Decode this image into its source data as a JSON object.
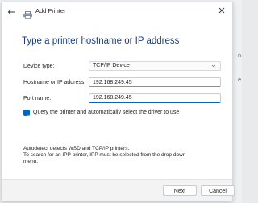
{
  "window": {
    "title": "Add Printer"
  },
  "heading": "Type a printer hostname or IP address",
  "form": {
    "device_type_label": "Device type:",
    "device_type_value": "TCP/IP Device",
    "hostname_label": "Hostname or IP address:",
    "hostname_value": "192.168.249.45",
    "port_label": "Port name:",
    "port_value": "192.168.249.45",
    "query_label": "Query the printer and automatically select the driver to use",
    "query_checked": true
  },
  "info": {
    "line1": "Autodetect detects WSD and TCP/IP printers.",
    "line2": "To search for an IPP printer, IPP must be selected from the drop down",
    "line3": "menu."
  },
  "buttons": {
    "next": "Next",
    "cancel": "Cancel"
  },
  "background": {
    "snippet1": "n",
    "snippet2": "e"
  },
  "colors": {
    "accent": "#0067c0",
    "heading": "#1b3f7a"
  },
  "icons": {
    "back": "back-arrow-icon",
    "printer": "printer-icon",
    "close": "close-icon",
    "dropdown": "chevron-down-icon",
    "checkbox": "checkmark-icon"
  }
}
